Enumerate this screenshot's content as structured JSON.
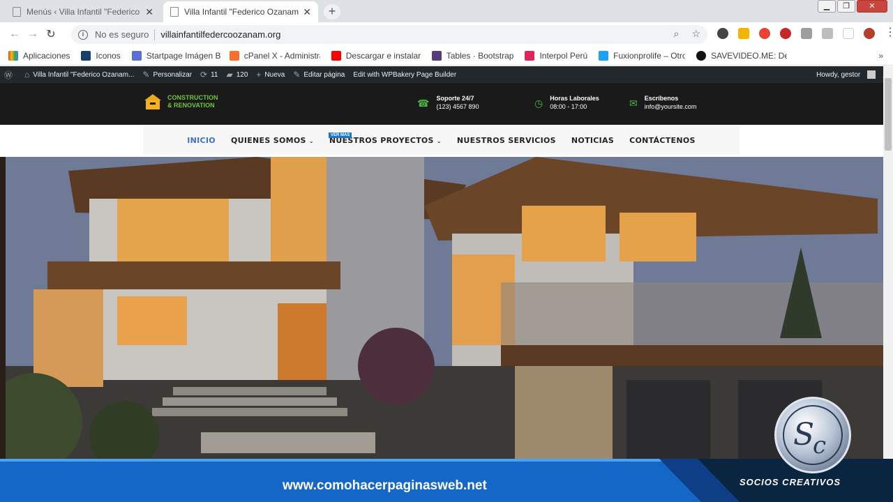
{
  "browser": {
    "tabs": [
      {
        "title": "Menús ‹ Villa Infantil \"Federico O",
        "active": false
      },
      {
        "title": "Villa Infantil \"Federico Ozanam\" –",
        "active": true
      }
    ],
    "new_tab": "+",
    "address": {
      "security": "No es seguro",
      "url": "villainfantilfedercoozanam.org"
    },
    "bookmarks": [
      {
        "label": "Aplicaciones",
        "color": "#ea4335"
      },
      {
        "label": "Iconos",
        "color": "#1a3d6e"
      },
      {
        "label": "Startpage Imágen Bu",
        "color": "#5b6fd6"
      },
      {
        "label": "cPanel X - Administra",
        "color": "#ff6c2c"
      },
      {
        "label": "Descargar e instalar p",
        "color": "#ff0000"
      },
      {
        "label": "Tables · Bootstrap",
        "color": "#563d7c"
      },
      {
        "label": "Interpol Perú",
        "color": "#e0245e"
      },
      {
        "label": "Fuxionprolife – Otro",
        "color": "#1da1f2"
      },
      {
        "label": "SAVEVIDEO.ME: Desc",
        "color": "#111111"
      }
    ]
  },
  "wp_admin": {
    "site": "Villa Infantil \"Federico Ozanam...",
    "customize": "Personalizar",
    "updates": "11",
    "comments": "120",
    "new": "Nueva",
    "edit": "Editar página",
    "wpbakery": "Edit with WPBakery Page Builder",
    "howdy": "Howdy, gestor"
  },
  "site": {
    "logo_line1": "CONSTRUCTION",
    "logo_line2": "& RENOVATION",
    "support_title": "Soporte 24/7",
    "support_value": "(123) 4567 890",
    "hours_title": "Horas Laborales",
    "hours_value": "08:00 - 17:00",
    "email_title": "Escríbenos",
    "email_value": "info@yoursite.com",
    "menu": [
      "INICIO",
      "QUIENES SOMOS",
      "NUESTROS PROYECTOS",
      "NUESTROS SERVICIOS",
      "NOTICIAS",
      "CONTÁCTENOS"
    ],
    "menu_badge": "VER MAS"
  },
  "overlay": {
    "url": "www.comohacerpaginasweb.net",
    "brand": "SOCIOS CREATIVOS"
  }
}
